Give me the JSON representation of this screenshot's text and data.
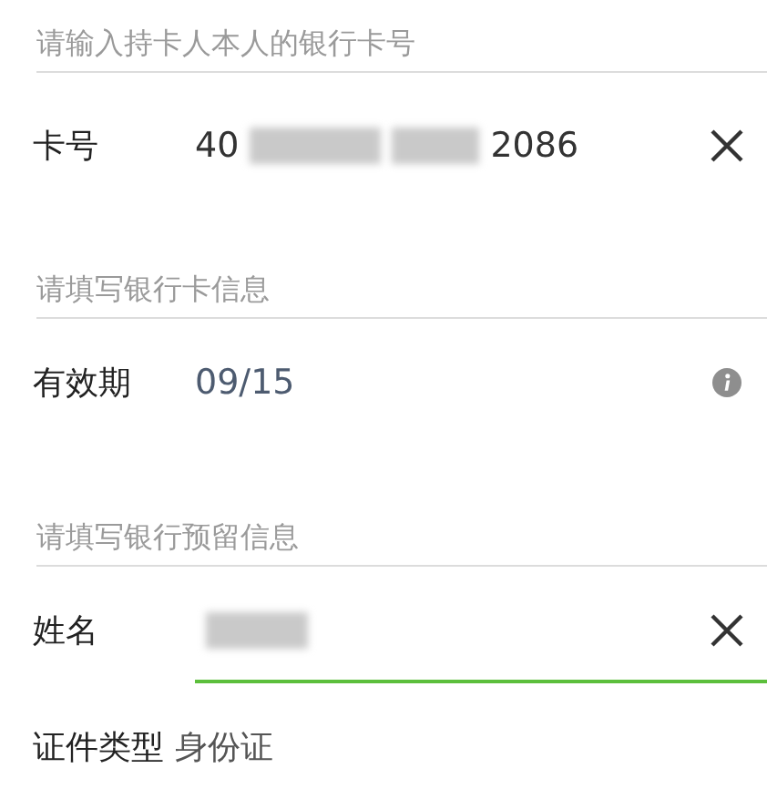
{
  "sections": [
    {
      "hint": "请输入持卡人本人的银行卡号",
      "field": {
        "kind": "card",
        "label": "卡号",
        "value_start": "40",
        "value_end": "2086",
        "action": {
          "kind": "clear"
        },
        "focused": false
      }
    },
    {
      "hint": "请填写银行卡信息",
      "field": {
        "kind": "date",
        "label": "有效期",
        "value": "09/15",
        "action": {
          "kind": "info"
        },
        "focused": false
      }
    },
    {
      "hint": "请填写银行预留信息",
      "field": {
        "kind": "name",
        "label": "姓名",
        "action": {
          "kind": "clear"
        },
        "focused": true
      }
    }
  ],
  "id_type": {
    "label": "证件类型",
    "value": "身份证"
  }
}
